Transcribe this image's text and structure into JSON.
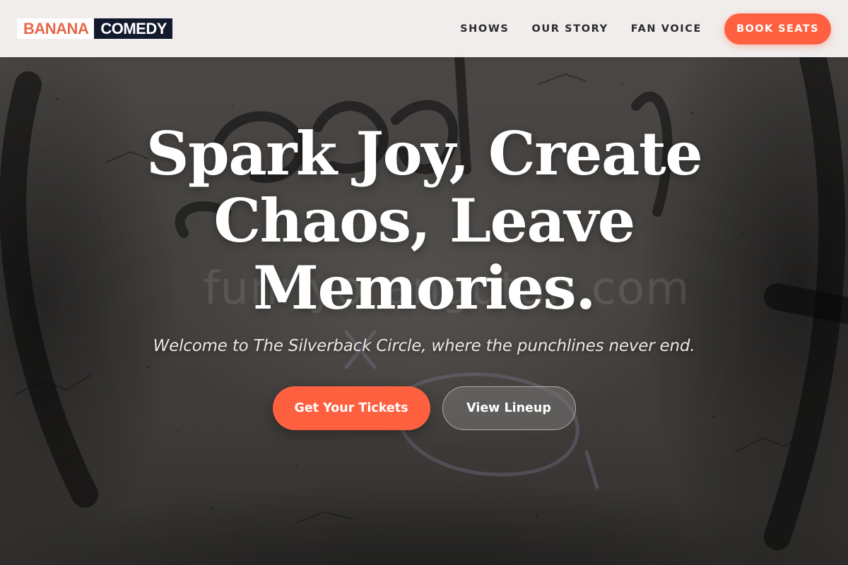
{
  "brand": {
    "part1": "BANANA",
    "part2": "COMEDY",
    "part1_color": "#e8674a",
    "part2_bg": "#141a2e"
  },
  "nav": {
    "links": [
      "SHOWS",
      "OUR STORY",
      "FAN VOICE"
    ],
    "cta": "BOOK SEATS"
  },
  "hero": {
    "title": "Spark Joy, Create Chaos, Leave Memories.",
    "subtitle": "Welcome to The Silverback Circle, where the punchlines never end.",
    "primary_button": "Get Your Tickets",
    "secondary_button": "View Lineup",
    "watermark": "funnyorangutan.com"
  },
  "colors": {
    "accent": "#ff6040",
    "nav_bg": "#f6f3f2",
    "nav_text": "#2b2b2b"
  },
  "icons": {
    "background": "graffiti-wall-image"
  }
}
